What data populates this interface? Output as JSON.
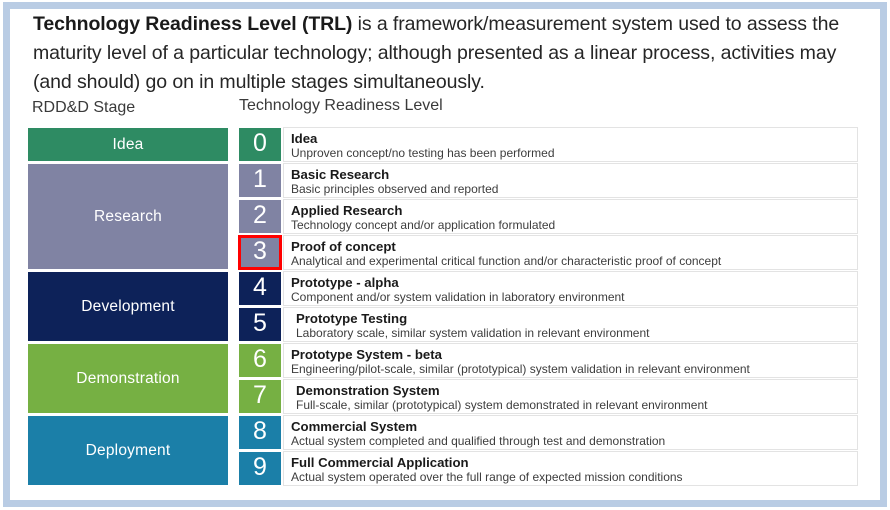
{
  "frame": {
    "border_color": "#b9cce4"
  },
  "intro": {
    "lead": "Technology Readiness Level (TRL)",
    "rest": " is a framework/measurement system used to assess the maturity level of a particular technology; although presented as a linear process, activities may (and should) go on in multiple stages simultaneously."
  },
  "headers": {
    "stage_column": "RDD&D Stage",
    "trl_column": "Technology Readiness Level"
  },
  "stages": [
    {
      "label": "Idea",
      "color": "#2e8b63",
      "rows": 1
    },
    {
      "label": "Research",
      "color": "#8083a3",
      "rows": 3
    },
    {
      "label": "Development",
      "color": "#0d2259",
      "rows": 2
    },
    {
      "label": "Demonstration",
      "color": "#76b043",
      "rows": 2
    },
    {
      "label": "Deployment",
      "color": "#1b7fa8",
      "rows": 2
    }
  ],
  "levels": [
    {
      "number": "0",
      "title": "Idea",
      "description": "Unproven concept/no testing has been performed",
      "color": "#2e8b63",
      "highlighted": false,
      "indent": false
    },
    {
      "number": "1",
      "title": "Basic Research",
      "description": "Basic principles observed and reported",
      "color": "#8083a3",
      "highlighted": false,
      "indent": false
    },
    {
      "number": "2",
      "title": "Applied Research",
      "description": "Technology concept and/or application formulated",
      "color": "#8083a3",
      "highlighted": false,
      "indent": false
    },
    {
      "number": "3",
      "title": "Proof of concept",
      "description": "Analytical and experimental critical function and/or characteristic proof of concept",
      "color": "#8083a3",
      "highlighted": true,
      "indent": false
    },
    {
      "number": "4",
      "title": "Prototype - alpha",
      "description": "Component and/or system validation in laboratory environment",
      "color": "#0d2259",
      "highlighted": false,
      "indent": false
    },
    {
      "number": "5",
      "title": "Prototype Testing",
      "description": "Laboratory scale, similar system validation in relevant environment",
      "color": "#0d2259",
      "highlighted": false,
      "indent": true
    },
    {
      "number": "6",
      "title": "Prototype System - beta",
      "description": "Engineering/pilot-scale, similar (prototypical) system validation in relevant environment",
      "color": "#76b043",
      "highlighted": false,
      "indent": false
    },
    {
      "number": "7",
      "title": "Demonstration System",
      "description": "Full-scale, similar (prototypical) system demonstrated in relevant environment",
      "color": "#76b043",
      "highlighted": false,
      "indent": true
    },
    {
      "number": "8",
      "title": "Commercial System",
      "description": "Actual system completed and qualified through test and demonstration",
      "color": "#1b7fa8",
      "highlighted": false,
      "indent": false
    },
    {
      "number": "9",
      "title": "Full Commercial Application",
      "description": "Actual system operated over the full range of expected mission conditions",
      "color": "#1b7fa8",
      "highlighted": false,
      "indent": false
    }
  ],
  "highlight": {
    "color": "#ff0000",
    "target_level": "3"
  }
}
